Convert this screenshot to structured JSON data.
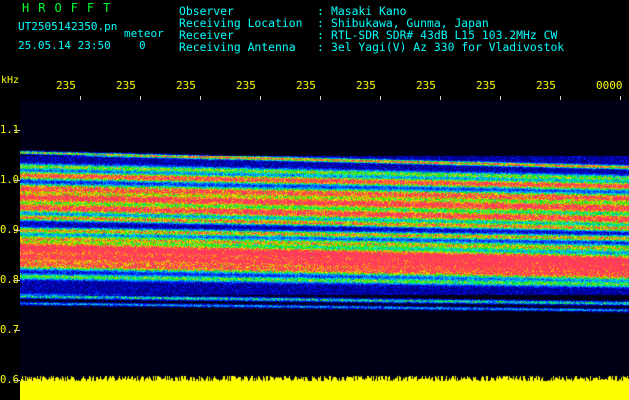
{
  "header": {
    "brand": "HROFFT",
    "filename": "UT2505142350.pn",
    "mode": "meteor",
    "datetime": "25.05.14 23:50",
    "counter": "0"
  },
  "station_info": [
    {
      "label": "Observer",
      "value": "Masaki Kano"
    },
    {
      "label": "Receiving Location",
      "value": "Shibukawa, Gunma, Japan"
    },
    {
      "label": "Receiver",
      "value": "RTL-SDR SDR# 43dB L15 103.2MHz CW"
    },
    {
      "label": "Receiving Antenna",
      "value": "3el Yagi(V) Az 330 for Vladivostok"
    }
  ],
  "separator": ":",
  "axis": {
    "unit": "kHz",
    "y_labels": [
      "1.1",
      "1.0",
      "0.9",
      "0.8",
      "0.7",
      "0.6"
    ],
    "time_labels": [
      "235",
      "235",
      "235",
      "235",
      "235",
      "235",
      "235",
      "235",
      "235",
      "0000"
    ]
  },
  "colors": {
    "header_green": "#00ff2a",
    "info_cyan": "#00ffff",
    "axis_yellow": "#ffff00",
    "background": "#000000",
    "noise_band": "#ffff00"
  }
}
